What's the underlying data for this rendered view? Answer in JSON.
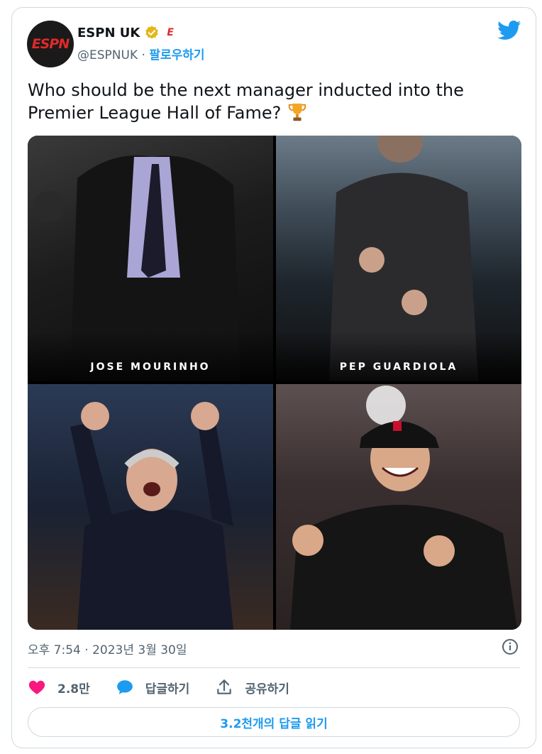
{
  "account": {
    "name": "ESPN UK",
    "handle": "@ESPNUK",
    "separator": "·",
    "follow_label": "팔로우하기",
    "logo_text": "ESPN",
    "badge_letter": "E"
  },
  "tweet": {
    "text_line1": "Who should be the next manager inducted into the",
    "text_line2": "Premier League Hall of Fame?",
    "timestamp": "오후 7:54 · 2023년 3월 30일"
  },
  "media": {
    "panels": [
      {
        "label": "JOSE MOURINHO"
      },
      {
        "label": "PEP GUARDIOLA"
      },
      {
        "label": ""
      },
      {
        "label": ""
      }
    ]
  },
  "actions": {
    "like_count": "2.8만",
    "reply_label": "답글하기",
    "share_label": "공유하기"
  },
  "read_replies_label": "3.2천개의 답글 읽기",
  "colors": {
    "accent": "#1d9bf0",
    "like": "#f91880",
    "verified": "#e2b719",
    "espn_red": "#e0292a"
  },
  "icons": [
    "espn-logo",
    "verified-badge-icon",
    "twitter-bird-icon",
    "trophy-icon",
    "info-icon",
    "heart-icon",
    "reply-bubble-icon",
    "share-icon"
  ]
}
